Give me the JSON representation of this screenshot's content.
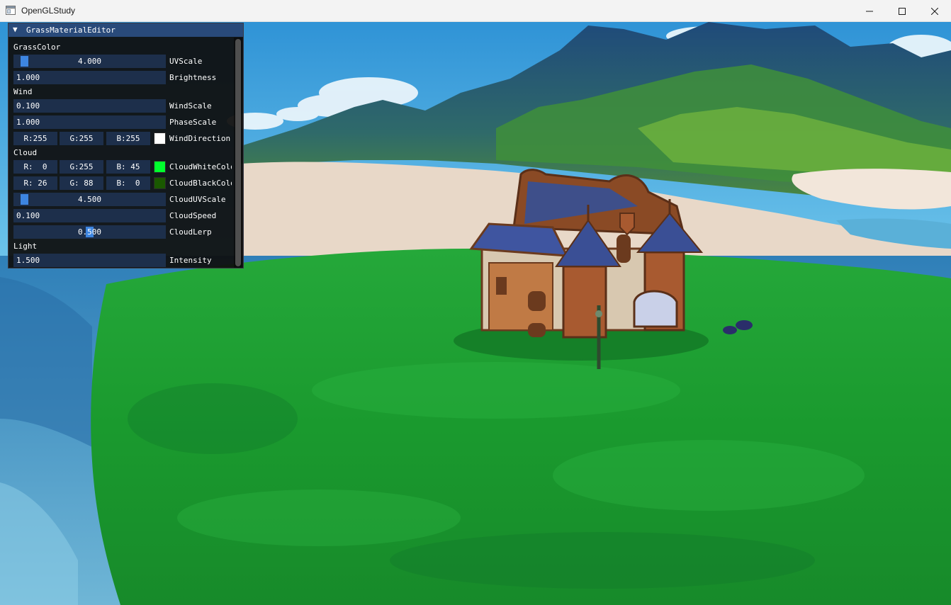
{
  "window": {
    "title": "OpenGLStudy",
    "controls": [
      "minimize",
      "maximize",
      "close"
    ]
  },
  "editor": {
    "title": "GrassMaterialEditor",
    "collapse_arrow": "▼",
    "sections": {
      "grass": "GrassColor",
      "wind": "Wind",
      "cloud": "Cloud",
      "light": "Light"
    },
    "fields": {
      "uv_scale": {
        "value": "4.000",
        "label": "UVScale",
        "grab_fraction": 0.03
      },
      "brightness": {
        "value": "1.000",
        "label": "Brightness"
      },
      "wind_scale": {
        "value": "0.100",
        "label": "WindScale"
      },
      "phase_scale": {
        "value": "1.000",
        "label": "PhaseScale"
      },
      "wind_direction": {
        "r": "R:255",
        "g": "G:255",
        "b": "B:255",
        "label": "WindDirection",
        "swatch": "#ffffff"
      },
      "cloud_white_color": {
        "r": "R:  0",
        "g": "G:255",
        "b": "B: 45",
        "label": "CloudWhiteColor",
        "swatch": "#00ff2d"
      },
      "cloud_black_color": {
        "r": "R: 26",
        "g": "G: 88",
        "b": "B:  0",
        "label": "CloudBlackColor",
        "swatch": "#1a5800"
      },
      "cloud_uv_scale": {
        "value": "4.500",
        "label": "CloudUVScale",
        "grab_fraction": 0.03
      },
      "cloud_speed": {
        "value": "0.100",
        "label": "CloudSpeed"
      },
      "cloud_lerp": {
        "value": "0.500",
        "label": "CloudLerp",
        "grab_fraction": 0.5
      },
      "intensity": {
        "value": "1.500",
        "label": "Intensity"
      }
    }
  },
  "colors": {
    "header_active": "#294a7a",
    "frame_bg": "#1d2f4b",
    "slider_grab": "#3d85e0",
    "grass": "#1a9a2e",
    "sky": "#3fa3dc"
  }
}
